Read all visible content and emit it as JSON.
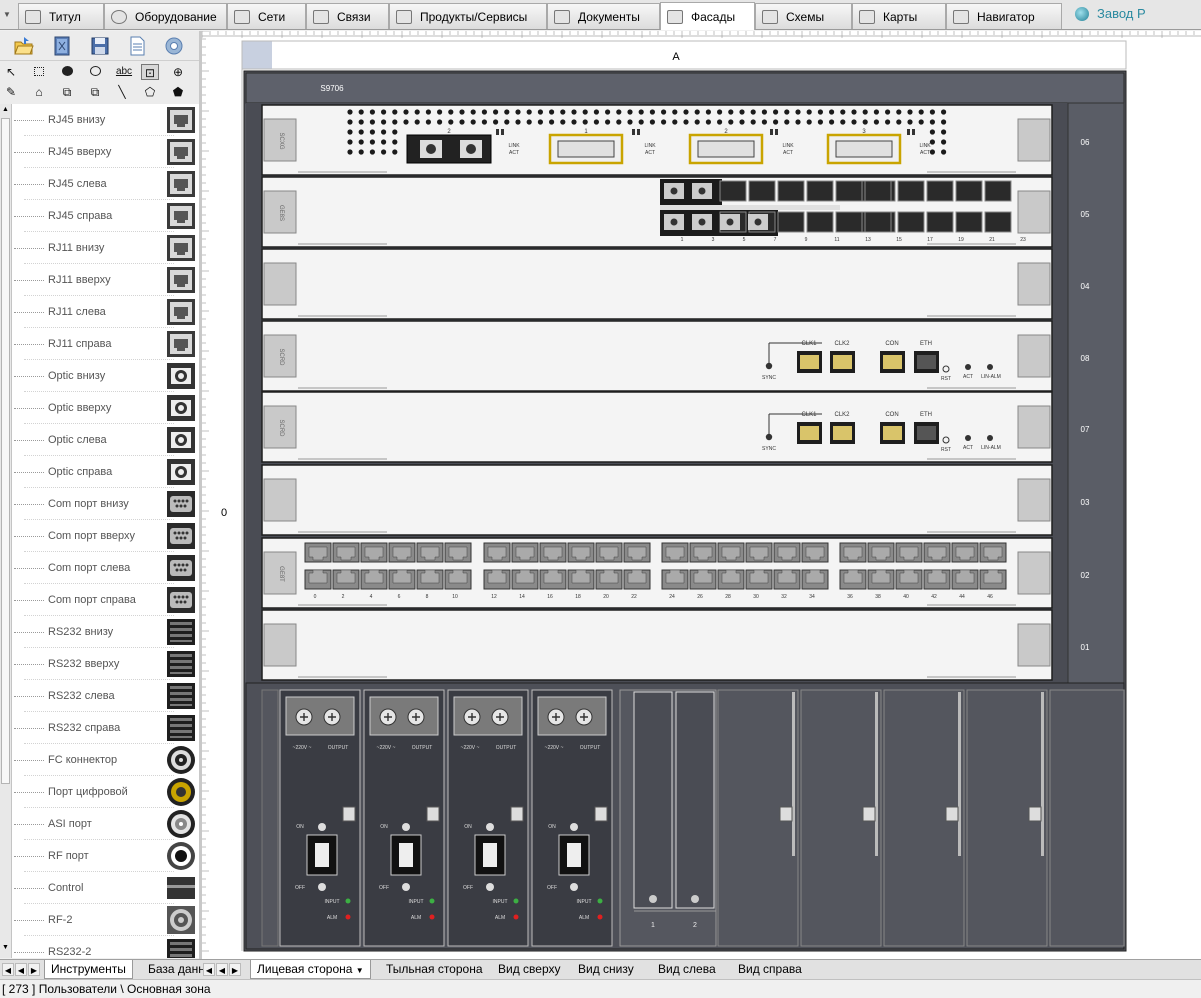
{
  "tabs": [
    {
      "label": "Титул",
      "icon": "title-icon"
    },
    {
      "label": "Оборудование",
      "icon": "equipment-icon"
    },
    {
      "label": "Сети",
      "icon": "network-icon"
    },
    {
      "label": "Связи",
      "icon": "links-icon"
    },
    {
      "label": "Продукты/Сервисы",
      "icon": "products-icon"
    },
    {
      "label": "Документы",
      "icon": "documents-icon"
    },
    {
      "label": "Фасады",
      "icon": "facades-icon",
      "active": true
    },
    {
      "label": "Схемы",
      "icon": "schemes-icon"
    },
    {
      "label": "Карты",
      "icon": "maps-icon"
    },
    {
      "label": "Навигатор",
      "icon": "navigator-icon"
    }
  ],
  "brand": "Завод Р",
  "toolbar": {
    "main": [
      "open-folder-icon",
      "book-icon",
      "save-icon",
      "document-icon",
      "settings-icon"
    ],
    "tools_row1": [
      "pointer-icon",
      "select-rect-icon",
      "filled-ellipse-icon",
      "ellipse-icon",
      "text-icon",
      "zoom-area-icon",
      "zoom-in-icon"
    ],
    "tools_row1_text_tool": "abc",
    "tools_row2": [
      "eyedropper-icon",
      "tag-icon",
      "group-icon",
      "ungroup-icon",
      "line-icon",
      "polygon-icon",
      "filled-polygon-icon"
    ]
  },
  "palette": [
    {
      "label": "RJ45 внизу",
      "type": "rj"
    },
    {
      "label": "RJ45 вверху",
      "type": "rj"
    },
    {
      "label": "RJ45 слева",
      "type": "rj"
    },
    {
      "label": "RJ45 справа",
      "type": "rj"
    },
    {
      "label": "RJ11 внизу",
      "type": "rj"
    },
    {
      "label": "RJ11 вверху",
      "type": "rj"
    },
    {
      "label": "RJ11 слева",
      "type": "rj"
    },
    {
      "label": "RJ11 справа",
      "type": "rj"
    },
    {
      "label": "Optic внизу",
      "type": "optic"
    },
    {
      "label": "Optic вверху",
      "type": "optic"
    },
    {
      "label": "Optic слева",
      "type": "optic"
    },
    {
      "label": "Optic справа",
      "type": "optic"
    },
    {
      "label": "Com порт внизу",
      "type": "com"
    },
    {
      "label": "Com порт вверху",
      "type": "com"
    },
    {
      "label": "Com порт слева",
      "type": "com"
    },
    {
      "label": "Com порт справа",
      "type": "com"
    },
    {
      "label": "RS232 внизу",
      "type": "rs"
    },
    {
      "label": "RS232 вверху",
      "type": "rs"
    },
    {
      "label": "RS232 слева",
      "type": "rs"
    },
    {
      "label": "RS232 справа",
      "type": "rs"
    },
    {
      "label": "FC коннектор",
      "type": "fc"
    },
    {
      "label": "Порт цифровой",
      "type": "digital"
    },
    {
      "label": "ASI порт",
      "type": "asi"
    },
    {
      "label": "RF порт",
      "type": "rf"
    },
    {
      "label": "Control",
      "type": "control"
    },
    {
      "label": "RF-2",
      "type": "rf2"
    },
    {
      "label": "RS232-2",
      "type": "rs"
    }
  ],
  "chassis": {
    "column_header": "A",
    "row_header": "0",
    "model": "S9706",
    "slots": [
      {
        "id": "06",
        "kind": "uplink",
        "name": "SCXG"
      },
      {
        "id": "05",
        "kind": "sfp",
        "name": "GE8S"
      },
      {
        "id": "04",
        "kind": "blank"
      },
      {
        "id": "08",
        "kind": "mpu",
        "name": "SCRD"
      },
      {
        "id": "07",
        "kind": "mpu",
        "name": "SCRD"
      },
      {
        "id": "03",
        "kind": "blank"
      },
      {
        "id": "02",
        "kind": "rj45",
        "name": "GE8T"
      },
      {
        "id": "01",
        "kind": "blank"
      }
    ],
    "uplink": {
      "port_nums": [
        "1",
        "2",
        "3"
      ],
      "optic_num": "2",
      "link_label": "LINK",
      "act_label": "ACT"
    },
    "mpu": {
      "labels": [
        "CLK1",
        "CLK2",
        "CON",
        "ETH"
      ],
      "sync": "SYNC",
      "rst": "RST",
      "act": "ACT",
      "lin": "LIN-ALM"
    },
    "sfp_bottom_nums": [
      "1",
      "3",
      "5",
      "7",
      "9",
      "11",
      "13",
      "15",
      "17",
      "19",
      "21",
      "23"
    ],
    "rj45_group_nums": [
      [
        "0",
        "2",
        "4",
        "6",
        "8",
        "10"
      ],
      [
        "12",
        "14",
        "16",
        "18",
        "20",
        "22"
      ],
      [
        "24",
        "26",
        "28",
        "30",
        "32",
        "34"
      ],
      [
        "36",
        "38",
        "40",
        "42",
        "44",
        "46"
      ]
    ],
    "psu_labels": {
      "mains": "~220V ~",
      "out": "OUTPUT",
      "alarm": "ALM",
      "on": "ON",
      "off": "OFF",
      "input": "INPUT",
      "fan": "FAN"
    },
    "psu_count": 4,
    "fan_numbers": [
      "1",
      "2"
    ]
  },
  "bottom_tabs": {
    "left": [
      "Инструменты",
      "База данн"
    ],
    "views": [
      "Лицевая сторона",
      "Тыльная сторона",
      "Вид сверху",
      "Вид снизу",
      "Вид слева",
      "Вид справа"
    ],
    "active_view": "Лицевая сторона"
  },
  "status": "[ 273 ] Пользователи \\ Основная зона"
}
